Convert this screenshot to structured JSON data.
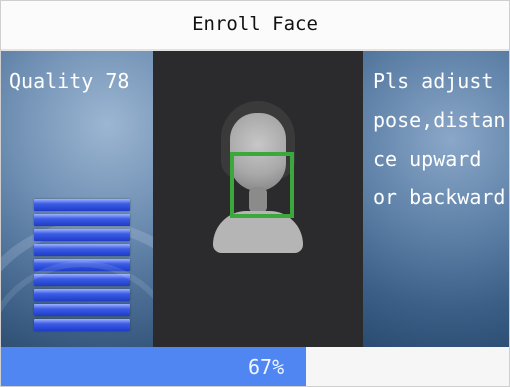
{
  "header": {
    "title": "Enroll Face"
  },
  "quality": {
    "text": "Quality 78",
    "bar_count": 9
  },
  "instructions": {
    "lines": [
      "Pls adjust",
      "pose,distan-",
      "ce upward",
      "or backward"
    ]
  },
  "progress": {
    "label": "67%",
    "value": 0.6
  },
  "colors": {
    "face_frame": "#3aa83a",
    "progress_fill": "#4f86f2",
    "quality_bar": "#1f3cc8"
  },
  "icons": {
    "face_frame": "face-detection-frame"
  }
}
